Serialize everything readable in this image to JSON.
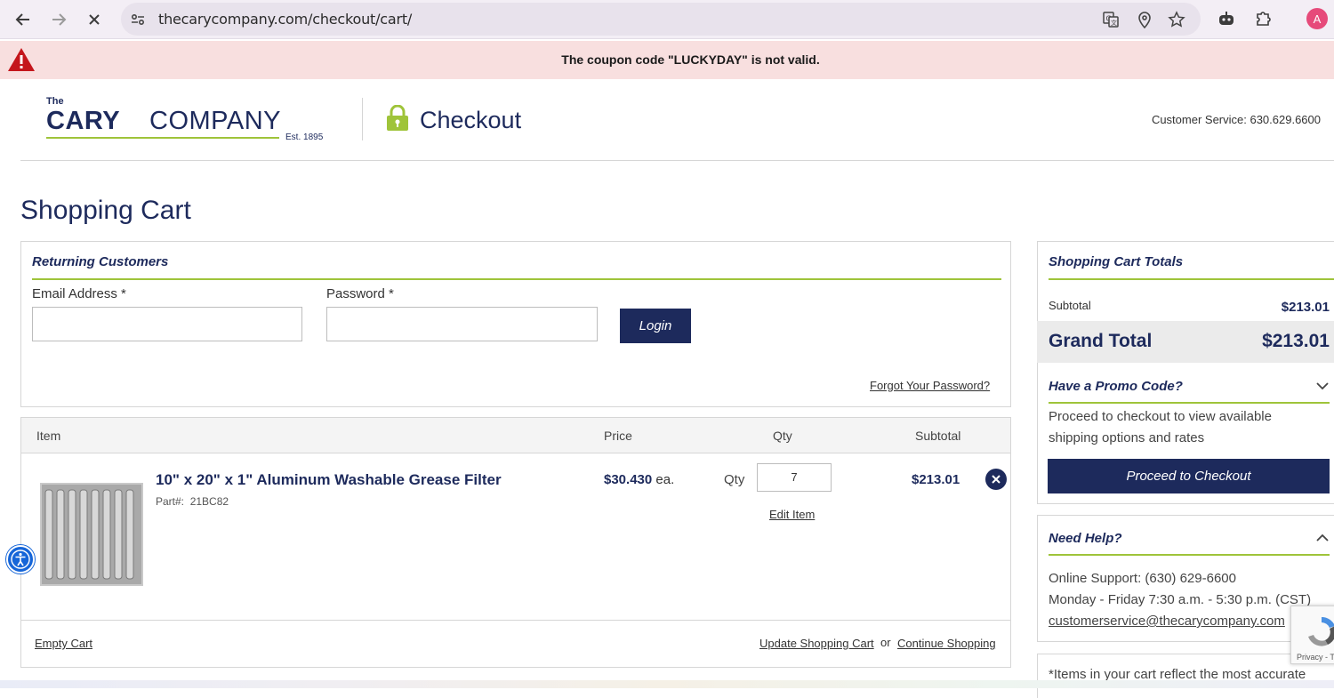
{
  "browser": {
    "url": "thecarycompany.com/checkout/cart/",
    "profile_initial": "A",
    "icons": [
      "back-icon",
      "forward-icon",
      "stop-loading-icon",
      "site-info-icon",
      "translate-icon",
      "location-icon",
      "bookmark-star-icon",
      "extension-robot-icon",
      "extensions-puzzle-icon"
    ]
  },
  "alert": {
    "message": "The coupon code \"LUCKYDAY\" is not valid.",
    "color": "#f8dfdf",
    "icon": "warning-triangle-icon"
  },
  "header": {
    "logo_the": "The",
    "logo_cary": "CARY",
    "logo_company": "COMPANY",
    "logo_est": "Est. 1895",
    "checkout_title": "Checkout",
    "customer_service": "Customer Service: 630.629.6600"
  },
  "page_title": "Shopping Cart",
  "login": {
    "heading": "Returning Customers",
    "email_label": "Email Address *",
    "email_value": "",
    "password_label": "Password *",
    "password_value": "",
    "login_button": "Login",
    "forgot_link": "Forgot Your Password?"
  },
  "cart": {
    "columns": {
      "item": "Item",
      "price": "Price",
      "qty": "Qty",
      "subtotal": "Subtotal"
    },
    "items": [
      {
        "name": "10\" x 20\" x 1\" Aluminum Washable Grease Filter",
        "part_label": "Part#:",
        "part_number": "21BC82",
        "price": "$30.430",
        "price_unit": "ea.",
        "qty_label": "Qty",
        "qty": "7",
        "edit_link": "Edit Item",
        "subtotal": "$213.01"
      }
    ],
    "empty_link": "Empty Cart",
    "update_link": "Update Shopping Cart",
    "or_text": "or",
    "continue_link": "Continue Shopping"
  },
  "totals": {
    "heading": "Shopping Cart Totals",
    "subtotal_label": "Subtotal",
    "subtotal_value": "$213.01",
    "grand_total_label": "Grand Total",
    "grand_total_value": "$213.01"
  },
  "promo": {
    "heading": "Have a Promo Code?",
    "note": "Proceed to checkout to view available shipping options and rates",
    "checkout_button": "Proceed to Checkout"
  },
  "help": {
    "heading": "Need Help?",
    "support": "Online Support: (630) 629-6600",
    "hours": "Monday - Friday 7:30 a.m. - 5:30 p.m. (CST)",
    "email": "customerservice@thecarycompany.com",
    "disclaimer": "*Items in your cart reflect the most accurate"
  },
  "recaptcha": {
    "text": "Privacy - T"
  },
  "colors": {
    "brand_navy": "#1d2a5c",
    "brand_green": "#9fc43a",
    "accessibility_blue": "#1565d8"
  }
}
